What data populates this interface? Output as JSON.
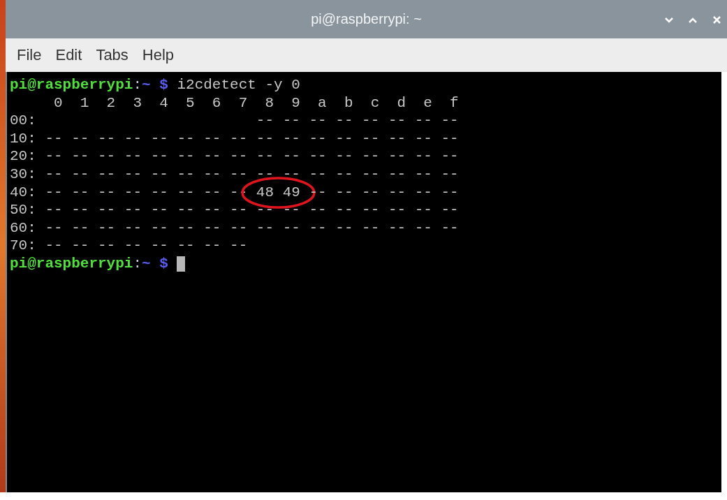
{
  "window": {
    "title": "pi@raspberrypi: ~"
  },
  "menu": [
    "File",
    "Edit",
    "Tabs",
    "Help"
  ],
  "terminal": {
    "lines": [
      {
        "segments": [
          {
            "kind": "user",
            "text": "pi@raspberrypi"
          },
          {
            "kind": "plain",
            "text": ":"
          },
          {
            "kind": "path",
            "text": "~ $"
          },
          {
            "kind": "plain",
            "text": " i2cdetect -y 0"
          }
        ]
      },
      {
        "segments": [
          {
            "kind": "plain",
            "text": "     0  1  2  3  4  5  6  7  8  9  a  b  c  d  e  f"
          }
        ]
      },
      {
        "segments": [
          {
            "kind": "plain",
            "text": "00:                         -- -- -- -- -- -- -- --"
          }
        ]
      },
      {
        "segments": [
          {
            "kind": "plain",
            "text": "10: -- -- -- -- -- -- -- -- -- -- -- -- -- -- -- --"
          }
        ]
      },
      {
        "segments": [
          {
            "kind": "plain",
            "text": "20: -- -- -- -- -- -- -- -- -- -- -- -- -- -- -- --"
          }
        ]
      },
      {
        "segments": [
          {
            "kind": "plain",
            "text": "30: -- -- -- -- -- -- -- -- -- -- -- -- -- -- -- --"
          }
        ]
      },
      {
        "segments": [
          {
            "kind": "plain",
            "text": "40: -- -- -- -- -- -- -- -- "
          },
          {
            "kind": "circled",
            "text": "48 49"
          },
          {
            "kind": "plain",
            "text": " -- -- -- -- -- --"
          }
        ]
      },
      {
        "segments": [
          {
            "kind": "plain",
            "text": "50: -- -- -- -- -- -- -- -- -- -- -- -- -- -- -- --"
          }
        ]
      },
      {
        "segments": [
          {
            "kind": "plain",
            "text": "60: -- -- -- -- -- -- -- -- -- -- -- -- -- -- -- --"
          }
        ]
      },
      {
        "segments": [
          {
            "kind": "plain",
            "text": "70: -- -- -- -- -- -- -- --"
          }
        ]
      },
      {
        "segments": [
          {
            "kind": "user",
            "text": "pi@raspberrypi"
          },
          {
            "kind": "plain",
            "text": ":"
          },
          {
            "kind": "path",
            "text": "~ $"
          },
          {
            "kind": "cursor"
          }
        ]
      }
    ]
  }
}
